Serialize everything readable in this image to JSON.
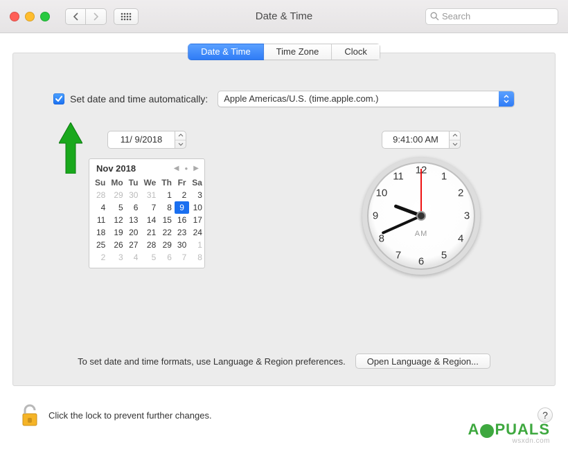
{
  "titlebar": {
    "title": "Date & Time",
    "search_placeholder": "Search"
  },
  "tabs": [
    {
      "label": "Date & Time",
      "active": true
    },
    {
      "label": "Time Zone",
      "active": false
    },
    {
      "label": "Clock",
      "active": false
    }
  ],
  "auto": {
    "checked": true,
    "label": "Set date and time automatically:",
    "server": "Apple Americas/U.S. (time.apple.com.)"
  },
  "date_field": "11/ 9/2018",
  "time_field": "9:41:00 AM",
  "clock": {
    "ampm": "AM",
    "hour": 9,
    "minute": 41,
    "second": 0
  },
  "calendar": {
    "month_label": "Nov 2018",
    "weekdays": [
      "Su",
      "Mo",
      "Tu",
      "We",
      "Th",
      "Fr",
      "Sa"
    ],
    "days": [
      {
        "n": 28,
        "other": true
      },
      {
        "n": 29,
        "other": true
      },
      {
        "n": 30,
        "other": true
      },
      {
        "n": 31,
        "other": true
      },
      {
        "n": 1
      },
      {
        "n": 2
      },
      {
        "n": 3
      },
      {
        "n": 4
      },
      {
        "n": 5
      },
      {
        "n": 6
      },
      {
        "n": 7
      },
      {
        "n": 8
      },
      {
        "n": 9,
        "sel": true
      },
      {
        "n": 10
      },
      {
        "n": 11
      },
      {
        "n": 12
      },
      {
        "n": 13
      },
      {
        "n": 14
      },
      {
        "n": 15
      },
      {
        "n": 16
      },
      {
        "n": 17
      },
      {
        "n": 18
      },
      {
        "n": 19
      },
      {
        "n": 20
      },
      {
        "n": 21
      },
      {
        "n": 22
      },
      {
        "n": 23
      },
      {
        "n": 24
      },
      {
        "n": 25
      },
      {
        "n": 26
      },
      {
        "n": 27
      },
      {
        "n": 28
      },
      {
        "n": 29
      },
      {
        "n": 30
      },
      {
        "n": 1,
        "other": true
      },
      {
        "n": 2,
        "other": true
      },
      {
        "n": 3,
        "other": true
      },
      {
        "n": 4,
        "other": true
      },
      {
        "n": 5,
        "other": true
      },
      {
        "n": 6,
        "other": true
      },
      {
        "n": 7,
        "other": true
      },
      {
        "n": 8,
        "other": true
      }
    ]
  },
  "hint": {
    "text": "To set date and time formats, use Language & Region preferences.",
    "button": "Open Language & Region..."
  },
  "footer": {
    "text": "Click the lock to prevent further changes."
  },
  "watermark": {
    "brand_pre": "A",
    "brand_post": "PUALS",
    "site": "wsxdn.com"
  }
}
